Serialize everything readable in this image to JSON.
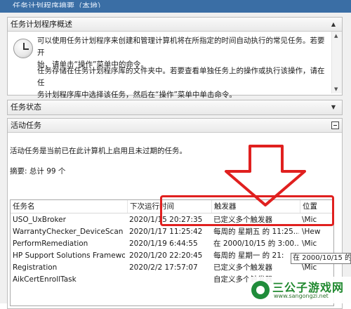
{
  "window": {
    "title": "任务计划程序摘要（本地）"
  },
  "overview": {
    "header": "任务计划程序概述",
    "paragraph1_line1": "可以使用任务计划程序来创建和管理计算机将在所指定的时间自动执行的常见任务。若要开",
    "paragraph1_line2": "始，请单击“操作”菜单中的命令。",
    "paragraph2_line1": "任务存储在任务计划程序库的文件夹中。若要查看单独任务上的操作或执行该操作，请在任",
    "paragraph2_line2": "务计划程序库中选择该任务，然后在“操作”菜单中单击命令。"
  },
  "task_status": {
    "header": "任务状态"
  },
  "active_tasks": {
    "header": "活动任务",
    "description": "活动任务是当前已在此计算机上启用且未过期的任务。",
    "summary": "摘要: 总计 99 个",
    "columns": [
      "任务名",
      "下次运行时间",
      "触发器",
      "位置"
    ],
    "rows": [
      [
        "USO_UxBroker",
        "2020/1/15 20:27:35",
        "已定义多个触发器",
        "\\Mic"
      ],
      [
        "WarrantyChecker_DeviceScan",
        "2020/1/17 11:25:42",
        "每周的 星期五 的 11:25...",
        "\\Hew"
      ],
      [
        "PerformRemediation",
        "2020/1/19 6:44:55",
        "在 2000/10/15 的 3:00...",
        "\\Mic"
      ],
      [
        "HP Support Solutions Framewo...",
        "2020/1/20 22:20:45",
        "每周的 星期一 的 21:",
        ""
      ],
      [
        "Registration",
        "2020/2/2 17:57:07",
        "已定义多个触发器",
        "\\Mic"
      ],
      [
        "AikCertEnrollTask",
        "",
        "自定义多个触发器",
        ""
      ]
    ],
    "tooltip": "在 2000/10/15 的"
  },
  "watermark": {
    "title": "三公子游戏网",
    "subtitle": "www.sangongzi.net"
  },
  "colors": {
    "highlight": "#e0201f",
    "titlebar": "#3a6ea5",
    "watermark_green": "#20892f"
  },
  "icons": {
    "overview_icon": "clock-icon",
    "arrow": "big-red-down-arrow"
  }
}
